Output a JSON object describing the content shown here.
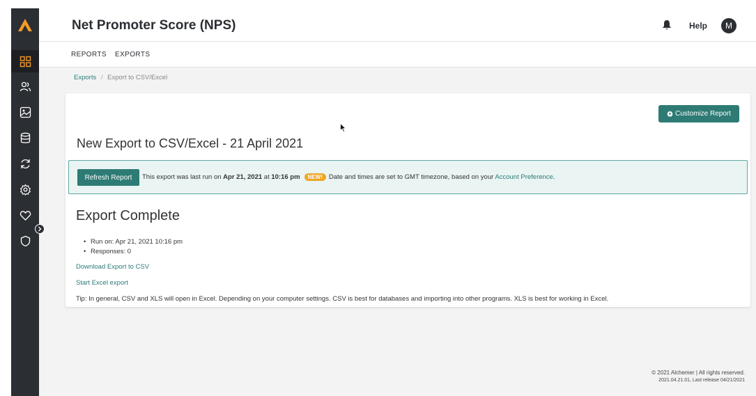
{
  "header": {
    "title": "Net Promoter Score (NPS)",
    "help_label": "Help",
    "avatar_initial": "M"
  },
  "subnav": {
    "reports_label": "REPORTS",
    "exports_label": "EXPORTS"
  },
  "breadcrumb": {
    "parent": "Exports",
    "separator": "/",
    "current": "Export to CSV/Excel"
  },
  "sidebar": {
    "items": [
      {
        "icon": "grid-icon",
        "active": true
      },
      {
        "icon": "users-icon"
      },
      {
        "icon": "image-icon"
      },
      {
        "icon": "database-icon"
      },
      {
        "icon": "refresh-icon"
      },
      {
        "icon": "gear-icon"
      },
      {
        "icon": "heart-icon"
      },
      {
        "icon": "shield-icon"
      }
    ],
    "accent": "#f49a27"
  },
  "card": {
    "customize_label": "Customize Report",
    "export_title": "New Export to CSV/Excel - 21 April 2021",
    "refresh_label": "Refresh Report",
    "info_prefix": "This export was last run on ",
    "info_date": "Apr 21, 2021",
    "info_at": " at ",
    "info_time": "10:16 pm",
    "new_badge": "NEW!",
    "info_tz": "Date and times are set to GMT timezone, based on your ",
    "account_link": "Account Preference",
    "info_end": ".",
    "complete_title": "Export Complete",
    "run_on": "Run on: Apr 21, 2021 10:16 pm",
    "responses": "Responses: 0",
    "download_link": "Download Export to CSV",
    "excel_link": "Start Excel export",
    "tip": "Tip: In general, CSV and XLS will open in Excel. Depending on your computer settings. CSV is best for databases and importing into other programs. XLS is best for working in Excel."
  },
  "footer": {
    "copyright": "© 2021 Alchemer | All rights reserved.",
    "release": "2021.04.21.01, Last release 04/21/2021"
  },
  "colors": {
    "primary": "#2e7b75",
    "link": "#2a7c78",
    "sidebar": "#2b2e33",
    "badge": "#f0a623"
  }
}
